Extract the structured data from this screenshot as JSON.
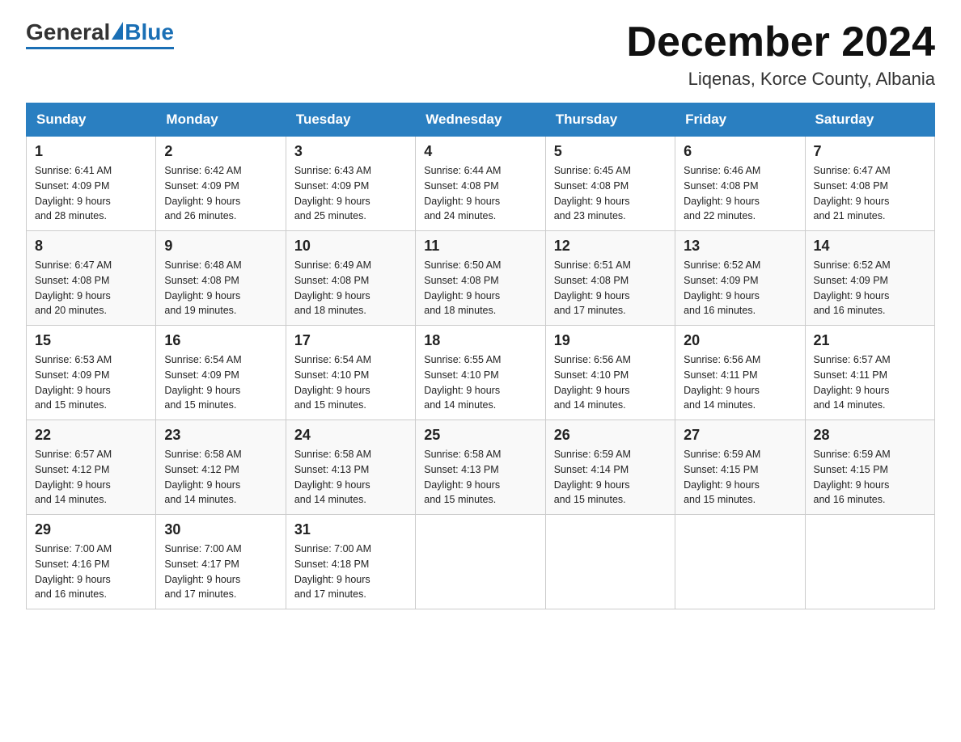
{
  "header": {
    "logo_general": "General",
    "logo_blue": "Blue",
    "month_title": "December 2024",
    "location": "Liqenas, Korce County, Albania"
  },
  "weekdays": [
    "Sunday",
    "Monday",
    "Tuesday",
    "Wednesday",
    "Thursday",
    "Friday",
    "Saturday"
  ],
  "weeks": [
    [
      {
        "day": "1",
        "sunrise": "6:41 AM",
        "sunset": "4:09 PM",
        "daylight": "9 hours and 28 minutes."
      },
      {
        "day": "2",
        "sunrise": "6:42 AM",
        "sunset": "4:09 PM",
        "daylight": "9 hours and 26 minutes."
      },
      {
        "day": "3",
        "sunrise": "6:43 AM",
        "sunset": "4:09 PM",
        "daylight": "9 hours and 25 minutes."
      },
      {
        "day": "4",
        "sunrise": "6:44 AM",
        "sunset": "4:08 PM",
        "daylight": "9 hours and 24 minutes."
      },
      {
        "day": "5",
        "sunrise": "6:45 AM",
        "sunset": "4:08 PM",
        "daylight": "9 hours and 23 minutes."
      },
      {
        "day": "6",
        "sunrise": "6:46 AM",
        "sunset": "4:08 PM",
        "daylight": "9 hours and 22 minutes."
      },
      {
        "day": "7",
        "sunrise": "6:47 AM",
        "sunset": "4:08 PM",
        "daylight": "9 hours and 21 minutes."
      }
    ],
    [
      {
        "day": "8",
        "sunrise": "6:47 AM",
        "sunset": "4:08 PM",
        "daylight": "9 hours and 20 minutes."
      },
      {
        "day": "9",
        "sunrise": "6:48 AM",
        "sunset": "4:08 PM",
        "daylight": "9 hours and 19 minutes."
      },
      {
        "day": "10",
        "sunrise": "6:49 AM",
        "sunset": "4:08 PM",
        "daylight": "9 hours and 18 minutes."
      },
      {
        "day": "11",
        "sunrise": "6:50 AM",
        "sunset": "4:08 PM",
        "daylight": "9 hours and 18 minutes."
      },
      {
        "day": "12",
        "sunrise": "6:51 AM",
        "sunset": "4:08 PM",
        "daylight": "9 hours and 17 minutes."
      },
      {
        "day": "13",
        "sunrise": "6:52 AM",
        "sunset": "4:09 PM",
        "daylight": "9 hours and 16 minutes."
      },
      {
        "day": "14",
        "sunrise": "6:52 AM",
        "sunset": "4:09 PM",
        "daylight": "9 hours and 16 minutes."
      }
    ],
    [
      {
        "day": "15",
        "sunrise": "6:53 AM",
        "sunset": "4:09 PM",
        "daylight": "9 hours and 15 minutes."
      },
      {
        "day": "16",
        "sunrise": "6:54 AM",
        "sunset": "4:09 PM",
        "daylight": "9 hours and 15 minutes."
      },
      {
        "day": "17",
        "sunrise": "6:54 AM",
        "sunset": "4:10 PM",
        "daylight": "9 hours and 15 minutes."
      },
      {
        "day": "18",
        "sunrise": "6:55 AM",
        "sunset": "4:10 PM",
        "daylight": "9 hours and 14 minutes."
      },
      {
        "day": "19",
        "sunrise": "6:56 AM",
        "sunset": "4:10 PM",
        "daylight": "9 hours and 14 minutes."
      },
      {
        "day": "20",
        "sunrise": "6:56 AM",
        "sunset": "4:11 PM",
        "daylight": "9 hours and 14 minutes."
      },
      {
        "day": "21",
        "sunrise": "6:57 AM",
        "sunset": "4:11 PM",
        "daylight": "9 hours and 14 minutes."
      }
    ],
    [
      {
        "day": "22",
        "sunrise": "6:57 AM",
        "sunset": "4:12 PM",
        "daylight": "9 hours and 14 minutes."
      },
      {
        "day": "23",
        "sunrise": "6:58 AM",
        "sunset": "4:12 PM",
        "daylight": "9 hours and 14 minutes."
      },
      {
        "day": "24",
        "sunrise": "6:58 AM",
        "sunset": "4:13 PM",
        "daylight": "9 hours and 14 minutes."
      },
      {
        "day": "25",
        "sunrise": "6:58 AM",
        "sunset": "4:13 PM",
        "daylight": "9 hours and 15 minutes."
      },
      {
        "day": "26",
        "sunrise": "6:59 AM",
        "sunset": "4:14 PM",
        "daylight": "9 hours and 15 minutes."
      },
      {
        "day": "27",
        "sunrise": "6:59 AM",
        "sunset": "4:15 PM",
        "daylight": "9 hours and 15 minutes."
      },
      {
        "day": "28",
        "sunrise": "6:59 AM",
        "sunset": "4:15 PM",
        "daylight": "9 hours and 16 minutes."
      }
    ],
    [
      {
        "day": "29",
        "sunrise": "7:00 AM",
        "sunset": "4:16 PM",
        "daylight": "9 hours and 16 minutes."
      },
      {
        "day": "30",
        "sunrise": "7:00 AM",
        "sunset": "4:17 PM",
        "daylight": "9 hours and 17 minutes."
      },
      {
        "day": "31",
        "sunrise": "7:00 AM",
        "sunset": "4:18 PM",
        "daylight": "9 hours and 17 minutes."
      },
      null,
      null,
      null,
      null
    ]
  ],
  "labels": {
    "sunrise": "Sunrise:",
    "sunset": "Sunset:",
    "daylight": "Daylight:"
  }
}
